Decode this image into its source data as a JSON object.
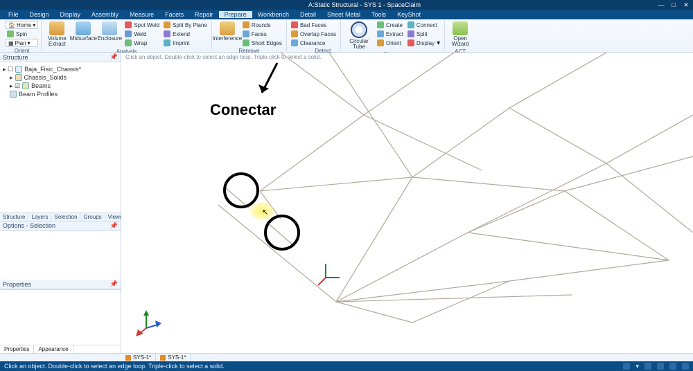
{
  "title": "A:Static Structural - SYS 1 - SpaceClaim",
  "menus": [
    "File",
    "Design",
    "Display",
    "Assembly",
    "Measure",
    "Facets",
    "Repair",
    "Prepare",
    "Workbench",
    "Detail",
    "Sheet Metal",
    "Tools",
    "KeyShot"
  ],
  "active_menu": 7,
  "ribbon": {
    "orient": {
      "home": "Home",
      "spin": "Spin",
      "plan": "Plan",
      "group": "Orient"
    },
    "analysis": {
      "volume": "Volume\nExtract",
      "midsurface": "Midsurface",
      "enclosure": "Enclosure",
      "spotweld": "Spot Weld",
      "weld": "Weld",
      "wrap": "Wrap",
      "splitbyplane": "Split By Plane",
      "extend": "Extend",
      "imprint": "Imprint",
      "group": "Analysis"
    },
    "remove": {
      "interference": "Interference",
      "rounds": "Rounds",
      "faces": "Faces",
      "shortedges": "Short Edges",
      "group": "Remove"
    },
    "detect": {
      "badfaces": "Bad Faces",
      "overlapfaces": "Overlap Faces",
      "clearance": "Clearance",
      "group": "Detect"
    },
    "beams": {
      "circulartube": "Circular Tube",
      "create": "Create",
      "extract": "Extract",
      "orient": "Orient",
      "connect": "Connect",
      "split": "Split",
      "display": "Display",
      "group": "Beams"
    },
    "act": {
      "openwizard": "Open\nWizard",
      "group": "ACT"
    }
  },
  "structure": {
    "header": "Structure",
    "root": "Baja_Fisic_Chassis*",
    "nodes": [
      "Chassis_Solids",
      "Beams",
      "Beam Profiles"
    ]
  },
  "side_tabs": [
    "Structure",
    "Layers",
    "Selection",
    "Groups",
    "Views"
  ],
  "options_header": "Options - Selection",
  "properties_header": "Properties",
  "bottom_left_tabs": [
    "Properties",
    "Appearance"
  ],
  "doc_tabs": [
    "SYS-1*",
    "SYS-1*"
  ],
  "viewport_hint": "Click an object. Double-click to select an edge loop. Triple-click to select a solid.",
  "annotation": "Conectar",
  "statusbar": "Click an object. Double-click to select an edge loop. Triple-click to select a solid."
}
